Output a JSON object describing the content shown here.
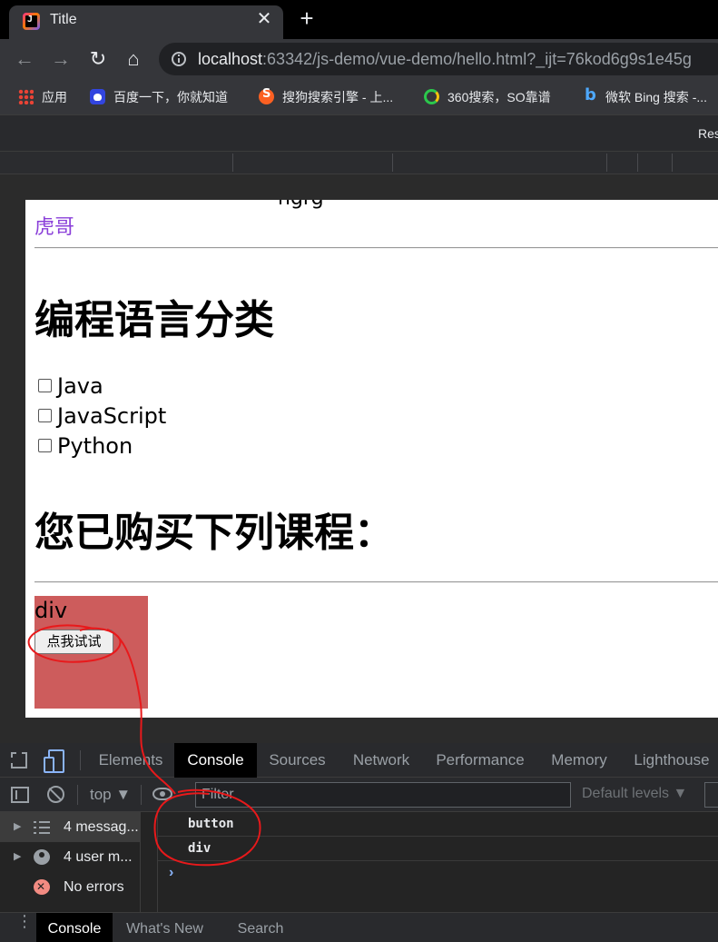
{
  "browser": {
    "tab_title": "Title",
    "tab_close": "✕",
    "new_tab": "+",
    "url_host": "localhost",
    "url_rest": ":63342/js-demo/vue-demo/hello.html?_ijt=76kod6g9s1e45g",
    "bookmarks": [
      {
        "label": "应用",
        "icon": "apps-grid-icon"
      },
      {
        "label": "百度一下，你就知道",
        "icon": "baidu-icon"
      },
      {
        "label": "搜狗搜索引擎 - 上...",
        "icon": "sogou-icon"
      },
      {
        "label": "360搜索，SO靠谱",
        "icon": "360-search-icon"
      },
      {
        "label": "微软 Bing 搜索 -...",
        "icon": "bing-icon"
      }
    ],
    "device_toolbar_text": "Res"
  },
  "page": {
    "cut_text": "hgrg",
    "link_text": "虎哥",
    "heading_languages": "编程语言分类",
    "languages": [
      "Java",
      "JavaScript",
      "Python"
    ],
    "heading_bought": "您已购买下列课程：",
    "div_label": "div",
    "button_label": "点我试试",
    "div_color": "#cd5c5c"
  },
  "devtools": {
    "tabs": [
      "Elements",
      "Console",
      "Sources",
      "Network",
      "Performance",
      "Memory",
      "Lighthouse"
    ],
    "active_tab": "Console",
    "context": "top ▼",
    "filter_placeholder": "Filter",
    "levels": "Default levels ▼",
    "sidebar": [
      {
        "label": "4 messag...",
        "icon": "list-icon"
      },
      {
        "label": "4 user m...",
        "icon": "user-icon"
      },
      {
        "label": "No errors",
        "icon": "error-icon"
      }
    ],
    "logs": [
      "button",
      "div"
    ],
    "prompt": "›",
    "drawer_tabs": [
      "Console",
      "What's New",
      "Search"
    ]
  },
  "annotation_color": "#e8191b"
}
